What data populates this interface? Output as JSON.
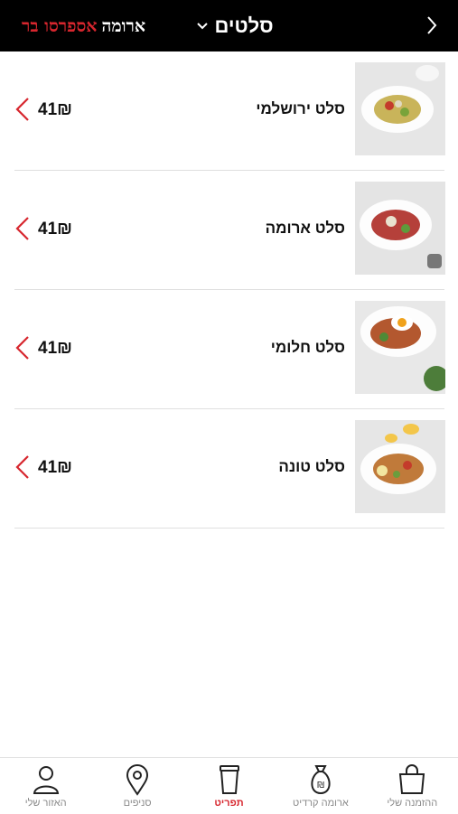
{
  "header": {
    "title": "סלטים",
    "brand_part1": "ארומה",
    "brand_part2": "אספרסו בר"
  },
  "items": [
    {
      "name": "סלט ירושלמי",
      "price": "41₪"
    },
    {
      "name": "סלט ארומה",
      "price": "41₪"
    },
    {
      "name": "סלט חלומי",
      "price": "41₪"
    },
    {
      "name": "סלט טונה",
      "price": "41₪"
    }
  ],
  "tabs": [
    {
      "label": "האזור שלי",
      "icon": "user-icon"
    },
    {
      "label": "סניפים",
      "icon": "location-pin-icon"
    },
    {
      "label": "תפריט",
      "icon": "coffee-cup-icon",
      "active": true
    },
    {
      "label": "ארומה קרדיט",
      "icon": "money-bag-icon"
    },
    {
      "label": "ההזמנה שלי",
      "icon": "shopping-bag-icon"
    }
  ],
  "colors": {
    "accent": "#d7262e",
    "header_bg": "#000000"
  }
}
